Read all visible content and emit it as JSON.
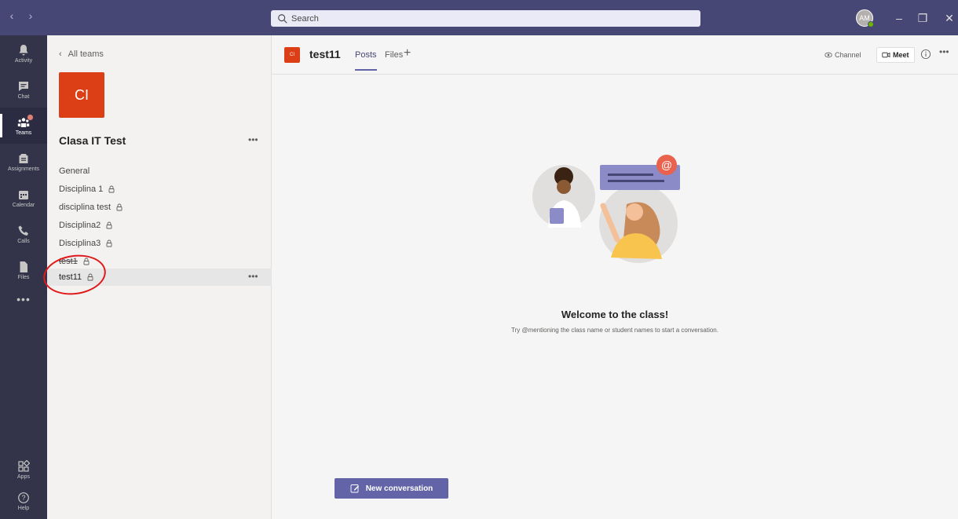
{
  "titlebar": {
    "search_placeholder": "Search",
    "avatar_initials": "AM",
    "minimize": "–",
    "maximize": "❐",
    "close": "✕"
  },
  "appbar": {
    "items": [
      {
        "label": "Activity",
        "icon": "bell-icon"
      },
      {
        "label": "Chat",
        "icon": "chat-icon"
      },
      {
        "label": "Teams",
        "icon": "teams-icon",
        "active": true,
        "badge": true
      },
      {
        "label": "Assignments",
        "icon": "assignments-icon"
      },
      {
        "label": "Calendar",
        "icon": "calendar-icon"
      },
      {
        "label": "Calls",
        "icon": "phone-icon"
      },
      {
        "label": "Files",
        "icon": "file-icon"
      }
    ],
    "more": "•••",
    "apps_label": "Apps",
    "help_label": "Help"
  },
  "teams_panel": {
    "back_label": "All teams",
    "team_initials": "CI",
    "team_name": "Clasa IT Test",
    "team_more": "•••",
    "channels": [
      {
        "label": "General",
        "locked": false
      },
      {
        "label": "Disciplina 1",
        "locked": true
      },
      {
        "label": "disciplina test",
        "locked": true
      },
      {
        "label": "Disciplina2",
        "locked": true
      },
      {
        "label": "Disciplina3",
        "locked": true
      },
      {
        "label": "test1",
        "locked": true
      },
      {
        "label": "test11",
        "locked": true,
        "active": true
      }
    ],
    "channel_more": "•••"
  },
  "main": {
    "channel_initials": "CI",
    "channel_title": "test11",
    "tabs": [
      {
        "label": "Posts",
        "active": true
      },
      {
        "label": "Files",
        "active": false
      }
    ],
    "tab_add": "+",
    "channel_btn": "Channel",
    "meet_btn": "Meet",
    "more": "•••",
    "welcome_title": "Welcome to the class!",
    "welcome_subtitle": "Try @mentioning the class name or student names to start a conversation.",
    "new_conversation": "New conversation"
  },
  "colors": {
    "titlebar": "#464775",
    "appbar": "#33344a",
    "brand": "#6264a7",
    "team_tile": "#dc3e15"
  }
}
